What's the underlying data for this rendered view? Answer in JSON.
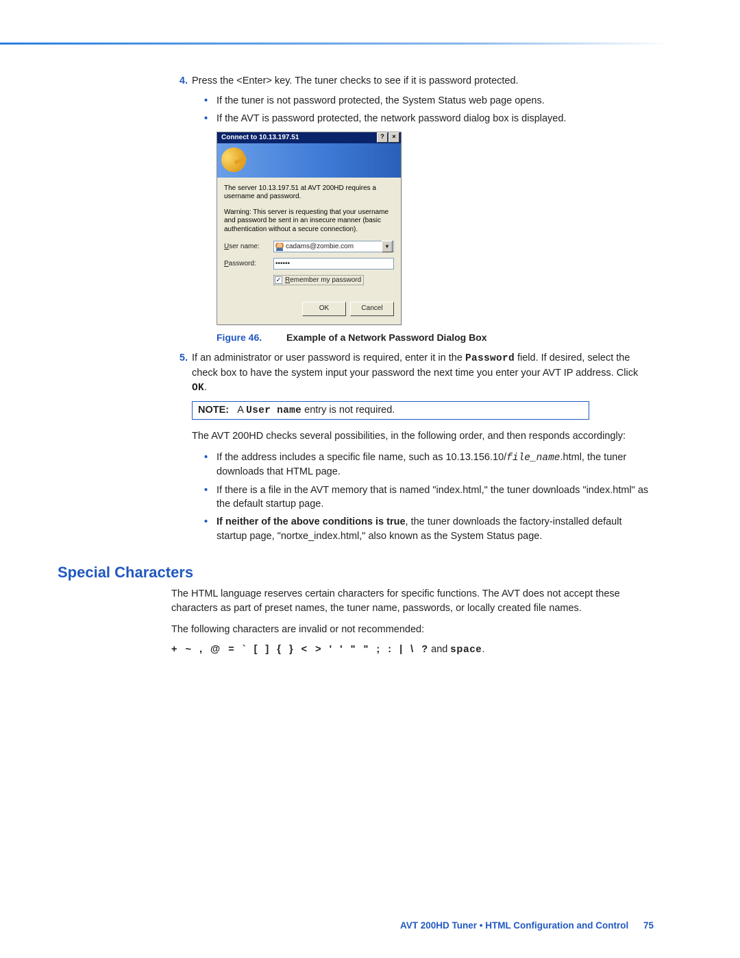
{
  "steps": {
    "s4": {
      "num": "4.",
      "text": "Press the <Enter> key. The tuner checks to see if it is password protected.",
      "bullets": [
        "If the tuner is not password protected, the System Status web page opens.",
        "If the AVT is password protected, the network password dialog box is displayed."
      ]
    },
    "s5": {
      "num": "5.",
      "text_pre": "If an administrator or user password is required, enter it in the ",
      "text_pwd": "Password",
      "text_mid": " field. If desired, select the check box to have the system input your password the next time you enter your AVT IP address. Click ",
      "text_ok": "OK",
      "text_post": "."
    }
  },
  "dialog": {
    "title": "Connect to 10.13.197.51",
    "help": "?",
    "close": "×",
    "p1": "The server 10.13.197.51 at AVT 200HD requires a username and password.",
    "p2": "Warning: This server is requesting that your username and password be sent in an insecure manner (basic authentication without a secure connection).",
    "label_user_u": "U",
    "label_user": "ser name:",
    "label_pass_u": "P",
    "label_pass": "assword:",
    "user_value": "cadams@zombie.com",
    "pass_value": "••••••",
    "remember_u": "R",
    "remember": "emember my password",
    "check_mark": "✓",
    "dd": "▼",
    "ok": "OK",
    "cancel": "Cancel"
  },
  "caption": {
    "num": "Figure 46.",
    "text": "Example of a Network Password Dialog Box"
  },
  "note": {
    "label": "NOTE:",
    "a": "A ",
    "user": "User name",
    "rest": " entry is not required."
  },
  "after5": {
    "p1": "The AVT 200HD checks several possibilities, in the following order, and then responds accordingly:",
    "b1_pre": "If the address includes a specific file name, such as 10.13.156.10/",
    "b1_fn": "file_name",
    "b1_post": ".html, the tuner downloads that HTML page.",
    "b2": "If there is a file in the AVT memory that is named \"index.html,\" the tuner downloads \"index.html\" as the default startup page.",
    "b3_bold": "If neither of the above conditions is true",
    "b3_rest": ", the tuner downloads the factory-installed default startup page, \"nortxe_index.html,\" also known as the System Status page."
  },
  "special": {
    "heading": "Special Characters",
    "p1": "The HTML language reserves certain characters for specific functions. The AVT does not accept these characters as part of preset names, the tuner name, passwords, or locally created file names.",
    "p2": "The following characters are invalid or not recommended:",
    "chars": "+ ~ , @ = ` [ ] { } < > ' ' \" \" ; : | \\ ?",
    "and": " and ",
    "space": "space",
    "dot": "."
  },
  "footer": {
    "title": "AVT 200HD Tuner • HTML Configuration and Control",
    "page": "75"
  }
}
